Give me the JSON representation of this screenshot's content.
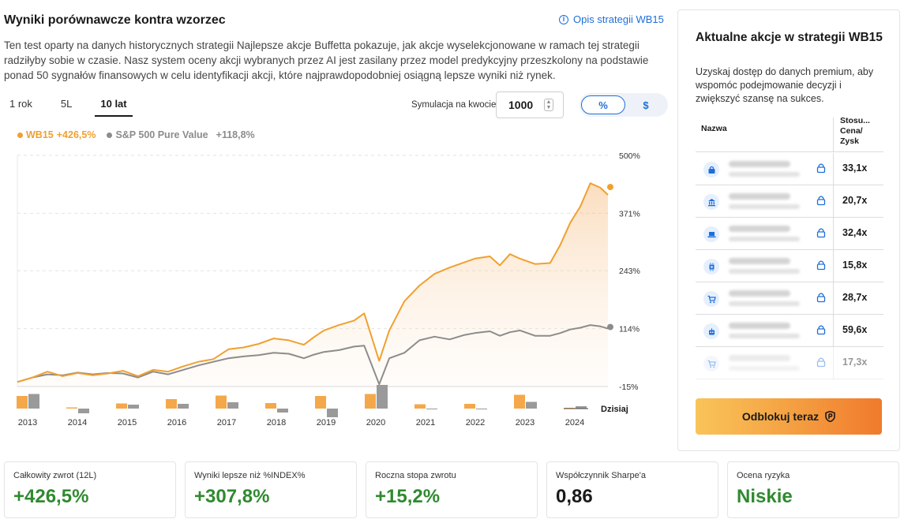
{
  "header": {
    "title": "Wyniki porównawcze kontra wzorzec",
    "strategy_link": "Opis strategii WB15",
    "description": "Ten test oparty na danych historycznych strategii Najlepsze akcje Buffetta pokazuje, jak akcje wyselekcjonowane w ramach tej strategii radziłyby sobie w czasie. Nasz system oceny akcji wybranych przez AI jest zasilany przez model predykcyjny przeszkolony na podstawie ponad 50 sygnałów finansowych w celu identyfikacji akcji, które najprawdopodobniej osiągną lepsze wyniki niż rynek."
  },
  "tabs": [
    {
      "label": "1 rok",
      "active": false
    },
    {
      "label": "5L",
      "active": false
    },
    {
      "label": "10 lat",
      "active": true
    }
  ],
  "simulation": {
    "label": "Symulacja na kwocie",
    "value": "1000"
  },
  "toggle": {
    "percent": "%",
    "dollar": "$"
  },
  "legend": {
    "wb_name": "WB15",
    "wb_value": "+426,5%",
    "sp_name": "S&P 500 Pure Value",
    "sp_value": "+118,8%"
  },
  "colors": {
    "wb": "#f0a030",
    "sp": "#8c8c8c",
    "accent": "#1e6fd9",
    "green": "#2f8a2f"
  },
  "chart_data": {
    "type": "line",
    "y_ticks": [
      "500%",
      "371%",
      "243%",
      "114%",
      "-15%"
    ],
    "y_tick_values": [
      500,
      371,
      243,
      114,
      -15
    ],
    "ylim": [
      -15,
      500
    ],
    "x_labels": [
      "2013",
      "2014",
      "2015",
      "2016",
      "2017",
      "2018",
      "2019",
      "2020",
      "2021",
      "2022",
      "2023",
      "2024"
    ],
    "today_label": "Dzisiaj",
    "series": [
      {
        "name": "WB15",
        "final_label": "+426,5%",
        "x": [
          2013.0,
          2013.3,
          2013.6,
          2013.9,
          2014.2,
          2014.5,
          2014.8,
          2015.1,
          2015.4,
          2015.7,
          2016.0,
          2016.3,
          2016.6,
          2016.9,
          2017.2,
          2017.5,
          2017.8,
          2018.1,
          2018.4,
          2018.7,
          2018.9,
          2019.1,
          2019.4,
          2019.7,
          2019.9,
          2020.2,
          2020.4,
          2020.7,
          2021.0,
          2021.3,
          2021.6,
          2021.9,
          2022.1,
          2022.4,
          2022.6,
          2022.8,
          2023.0,
          2023.3,
          2023.6,
          2023.8,
          2024.0,
          2024.2,
          2024.4,
          2024.6,
          2024.75
        ],
        "y": [
          -5,
          5,
          18,
          8,
          15,
          10,
          14,
          20,
          8,
          22,
          18,
          30,
          40,
          46,
          68,
          72,
          80,
          92,
          88,
          78,
          95,
          110,
          122,
          132,
          148,
          42,
          110,
          175,
          210,
          236,
          250,
          262,
          270,
          275,
          255,
          280,
          270,
          258,
          260,
          300,
          350,
          386,
          438,
          428,
          412
        ]
      },
      {
        "name": "S&P 500 Pure Value",
        "final_label": "+118,8%",
        "x": [
          2013.0,
          2013.3,
          2013.6,
          2013.9,
          2014.2,
          2014.5,
          2014.8,
          2015.1,
          2015.4,
          2015.7,
          2016.0,
          2016.3,
          2016.6,
          2016.9,
          2017.2,
          2017.5,
          2017.8,
          2018.1,
          2018.4,
          2018.7,
          2018.9,
          2019.1,
          2019.4,
          2019.7,
          2019.9,
          2020.2,
          2020.4,
          2020.7,
          2021.0,
          2021.3,
          2021.6,
          2021.9,
          2022.1,
          2022.4,
          2022.6,
          2022.8,
          2023.0,
          2023.3,
          2023.6,
          2023.8,
          2024.0,
          2024.2,
          2024.4,
          2024.6,
          2024.75
        ],
        "y": [
          -5,
          5,
          12,
          10,
          16,
          12,
          15,
          14,
          5,
          18,
          12,
          22,
          32,
          40,
          48,
          52,
          55,
          60,
          58,
          48,
          56,
          62,
          66,
          74,
          76,
          -10,
          48,
          60,
          88,
          96,
          90,
          100,
          104,
          108,
          98,
          106,
          110,
          98,
          98,
          104,
          112,
          116,
          122,
          119,
          114
        ]
      }
    ],
    "annual_bars": {
      "categories": [
        "2013",
        "2014",
        "2015",
        "2016",
        "2017",
        "2018",
        "2019",
        "2020",
        "2021",
        "2022",
        "2023",
        "2024"
      ],
      "wb": [
        32,
        3,
        13,
        24,
        33,
        14,
        32,
        37,
        11,
        12,
        35,
        2
      ],
      "sp": [
        37,
        -12,
        10,
        12,
        16,
        -10,
        -22,
        60,
        0,
        0,
        17,
        6
      ]
    },
    "grid": true
  },
  "right_panel": {
    "title": "Aktualne akcje w strategii WB15",
    "subtitle": "Uzyskaj dostęp do danych premium, aby wspomóc podejmowanie decyzji i zwiększyć szansę na sukces.",
    "col_name": "Nazwa",
    "col_ratio": "Stosu... Cena/ Zysk",
    "rows": [
      {
        "icon": "bag-icon",
        "ratio": "33,1x"
      },
      {
        "icon": "bank-icon",
        "ratio": "20,7x"
      },
      {
        "icon": "laptop-icon",
        "ratio": "32,4x"
      },
      {
        "icon": "chip-icon",
        "ratio": "15,8x"
      },
      {
        "icon": "cart-icon",
        "ratio": "28,7x"
      },
      {
        "icon": "robot-icon",
        "ratio": "59,6x"
      },
      {
        "icon": "cart-icon",
        "ratio": "17,3x"
      }
    ],
    "unlock_button": "Odblokuj teraz"
  },
  "stats": [
    {
      "label": "Całkowity zwrot (12L)",
      "value": "+426,5%",
      "color": "green"
    },
    {
      "label": "Wyniki lepsze niż %INDEX%",
      "value": "+307,8%",
      "color": "green"
    },
    {
      "label": "Roczna stopa zwrotu",
      "value": "+15,2%",
      "color": "green"
    },
    {
      "label": "Współczynnik Sharpe'a",
      "value": "0,86",
      "color": "dark"
    },
    {
      "label": "Ocena ryzyka",
      "value": "Niskie",
      "color": "green"
    }
  ]
}
